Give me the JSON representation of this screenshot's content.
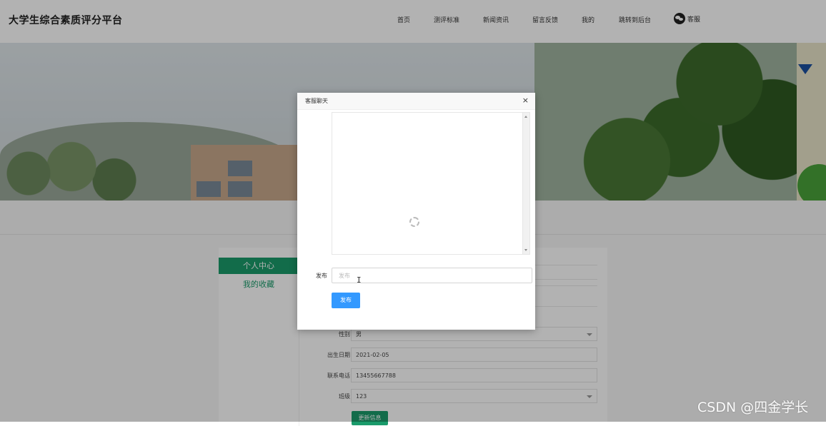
{
  "header": {
    "site_title": "大学生综合素质评分平台",
    "nav": [
      "首页",
      "测评标准",
      "新闻资讯",
      "留言反馈",
      "我的",
      "跳转到后台"
    ],
    "kefu_label": "客服",
    "kefu_icon": "wechat-icon"
  },
  "sidebar": {
    "items": [
      {
        "label": "个人中心",
        "active": true
      },
      {
        "label": "我的收藏",
        "active": false
      }
    ]
  },
  "form": {
    "fields": [
      {
        "label": "性别",
        "value": "男",
        "type": "select"
      },
      {
        "label": "出生日期",
        "value": "2021-02-05",
        "type": "text"
      },
      {
        "label": "联系电话",
        "value": "13455667788",
        "type": "text"
      },
      {
        "label": "班级",
        "value": "123",
        "type": "select"
      }
    ],
    "submit_label": "更新信息"
  },
  "modal": {
    "title": "客服聊天",
    "close_icon": "×",
    "post_label": "发布",
    "post_placeholder": "发布",
    "post_button": "发布"
  },
  "watermark": "CSDN @四金学长",
  "colors": {
    "primary_green": "#1a9b6b",
    "post_button_blue": "#3399ff"
  }
}
